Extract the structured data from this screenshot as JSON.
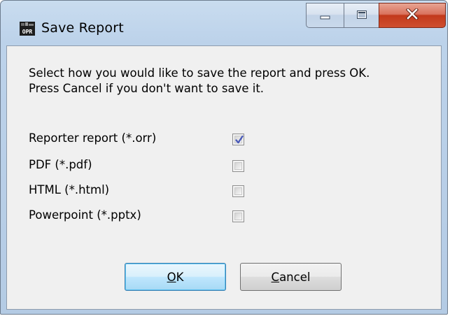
{
  "window": {
    "title": "Save Report",
    "app_icon_text": "OPR"
  },
  "caption_buttons": {
    "minimize_icon": "minimize-icon",
    "maximize_icon": "maximize-icon",
    "close_icon": "close-icon"
  },
  "instructions": "Select how you would like to save the report and press OK.\nPress Cancel if you don't want to save it.",
  "options": [
    {
      "label": "Reporter report (*.orr)",
      "checked": true
    },
    {
      "label": "PDF (*.pdf)",
      "checked": false
    },
    {
      "label": "HTML (*.html)",
      "checked": false
    },
    {
      "label": "Powerpoint (*.pptx)",
      "checked": false
    }
  ],
  "buttons": {
    "ok_mnemonic": "O",
    "ok_rest": "K",
    "cancel_mnemonic": "C",
    "cancel_rest": "ancel"
  },
  "colors": {
    "check_mark": "#4a5ab8",
    "close_button": "#c2391b",
    "default_button_border": "#3c7fb1"
  }
}
